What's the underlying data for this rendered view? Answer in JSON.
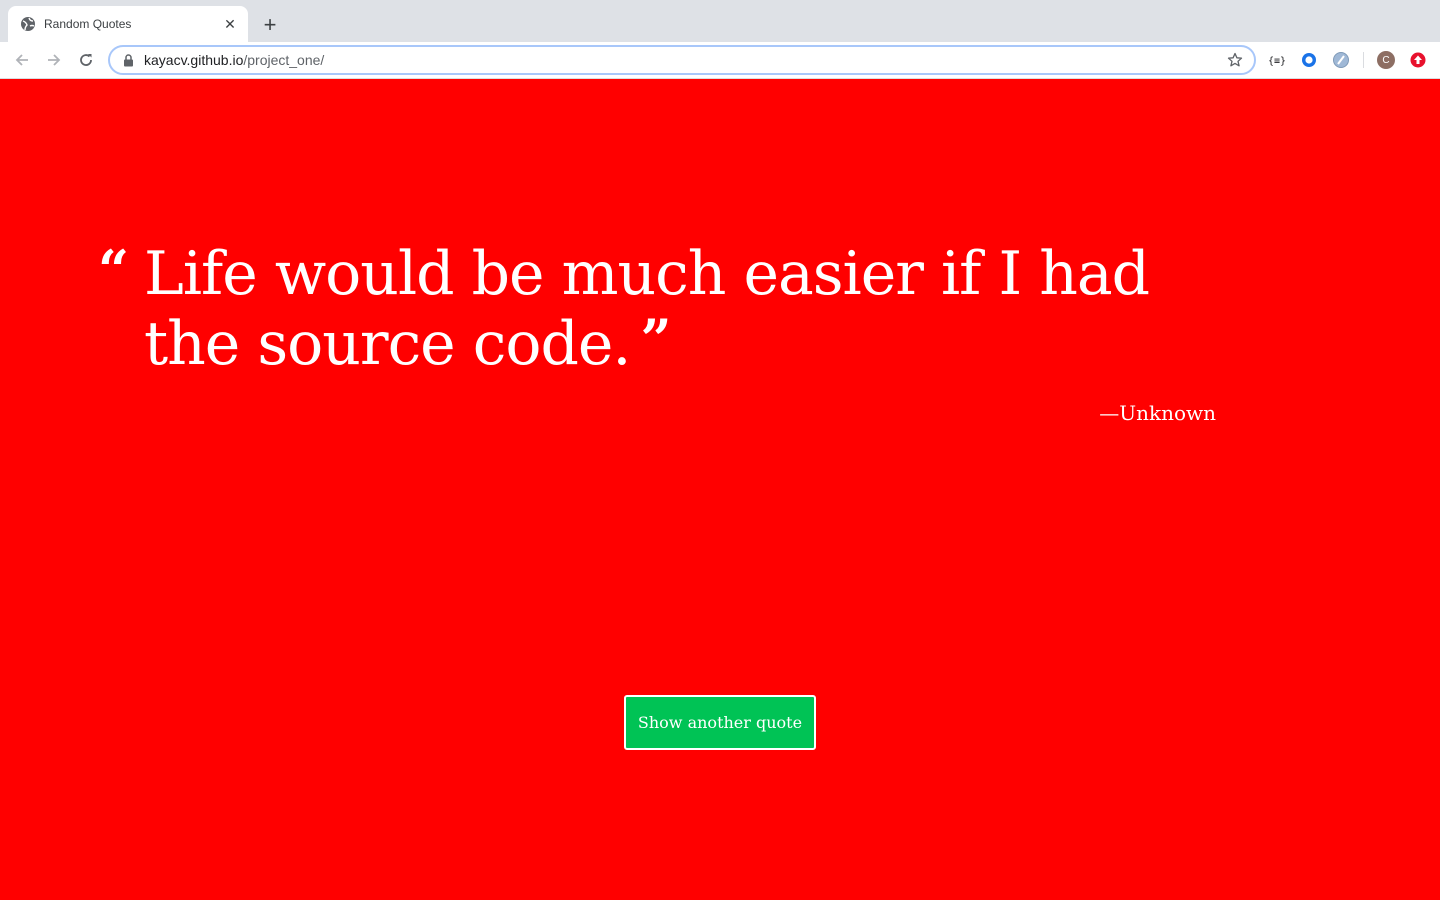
{
  "browser": {
    "tab": {
      "title": "Random Quotes",
      "favicon": "globe-icon",
      "close_glyph": "✕"
    },
    "new_tab_glyph": "+",
    "url": {
      "host": "kayacv.github.io",
      "path": "/project_one/"
    },
    "extensions": [
      "json-formatter-icon",
      "ring-extension-icon",
      "sync-extension-icon",
      "profile-avatar",
      "update-extension-icon"
    ],
    "avatar_letter": "C"
  },
  "page": {
    "background_color": "#ff0000",
    "quote": {
      "open_mark": "“",
      "text": "Life would be much easier if I had the source code.",
      "close_mark": "”",
      "attribution": "—Unknown"
    },
    "button": {
      "label": "Show another quote",
      "color": "#00c355"
    }
  }
}
